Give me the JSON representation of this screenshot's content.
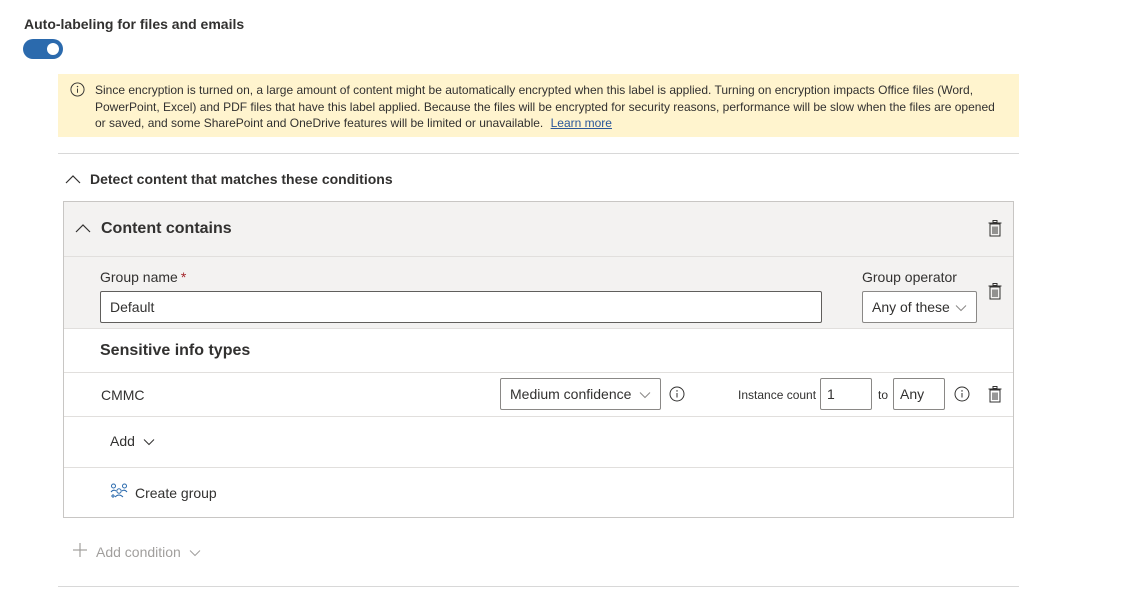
{
  "section": {
    "title": "Auto-labeling for files and emails",
    "toggle_on": true
  },
  "banner": {
    "text": "Since encryption is turned on, a large amount of content might be automatically encrypted when this label is applied. Turning on encryption impacts Office files (Word, PowerPoint, Excel) and PDF files that have this label applied. Because the files will be encrypted for security reasons, performance will be slow when the files are opened or saved, and some SharePoint and OneDrive features will be limited or unavailable.",
    "link": "Learn more"
  },
  "detect": {
    "title": "Detect content that matches these conditions"
  },
  "content_contains": {
    "title": "Content contains",
    "group_name_label": "Group name",
    "required_mark": "*",
    "group_name_value": "Default",
    "group_operator_label": "Group operator",
    "group_operator_value": "Any of these",
    "sit_title": "Sensitive info types",
    "sit_rows": [
      {
        "name": "CMMC",
        "confidence": "Medium confidence",
        "instance_label": "Instance count",
        "instance_min": "1",
        "to_label": "to",
        "instance_max": "Any"
      }
    ],
    "add_label": "Add",
    "create_group_label": "Create group"
  },
  "add_condition": {
    "label": "Add condition"
  },
  "colors": {
    "accent": "#2b6aad",
    "banner_bg": "#fff4ce",
    "required": "#a4262c",
    "link": "#2b579a"
  },
  "icons": [
    "info-icon",
    "chevron-up-icon",
    "chevron-down-icon",
    "trash-icon",
    "create-group-icon",
    "plus-icon"
  ]
}
